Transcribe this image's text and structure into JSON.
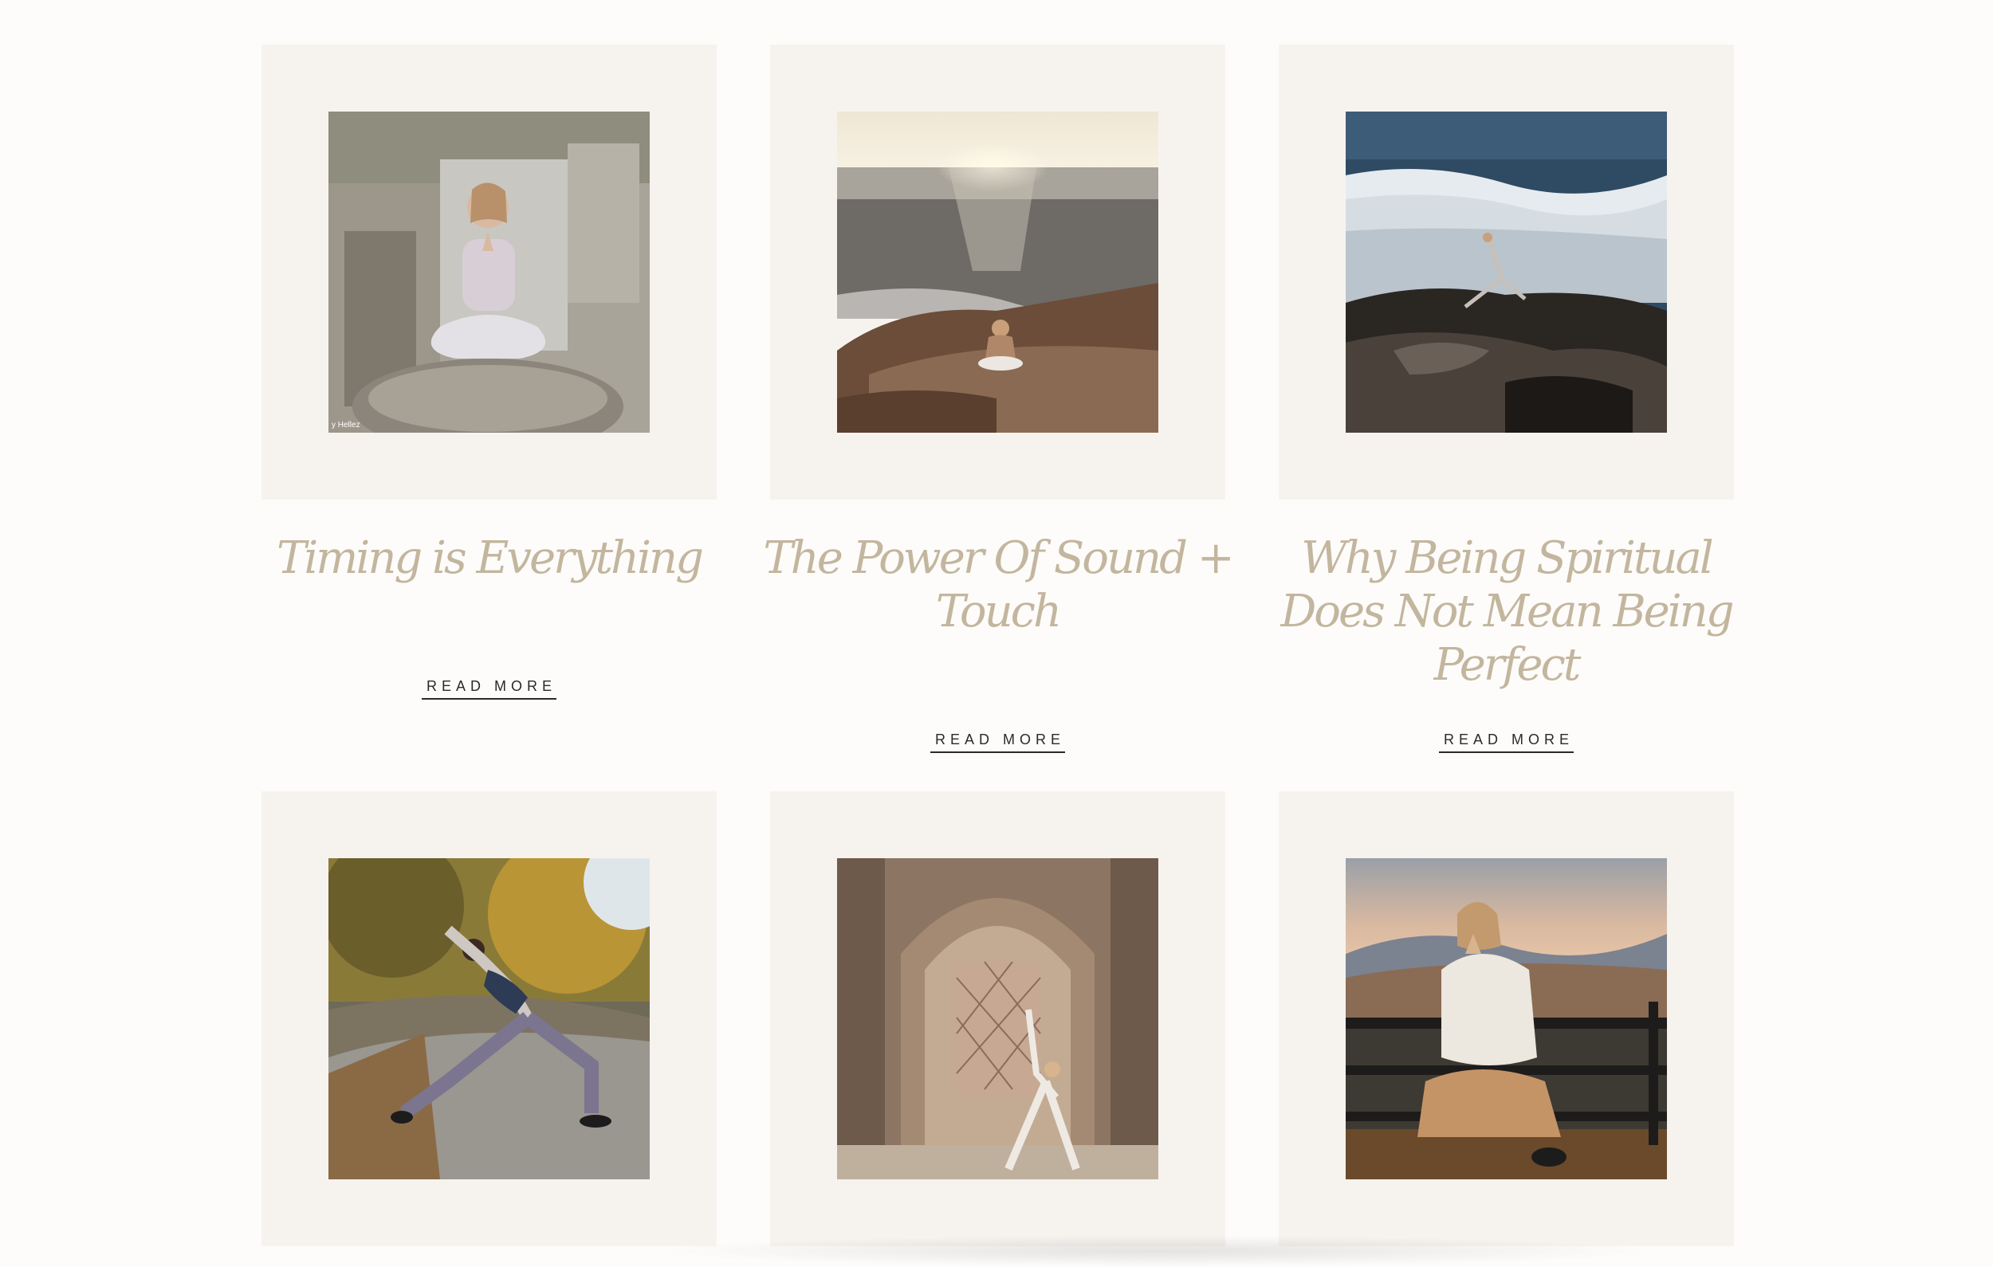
{
  "posts": [
    {
      "title": "Timing is Everything",
      "read_more": "READ MORE",
      "photo": "meditation-on-rock-photo",
      "watermark": "y Hellez"
    },
    {
      "title": "The Power Of Sound + Touch",
      "read_more": "READ MORE",
      "photo": "ocean-sunset-meditation-photo"
    },
    {
      "title": "Why Being Spiritual Does Not Mean Being Perfect",
      "read_more": "READ MORE",
      "photo": "rocky-shore-pose-photo"
    },
    {
      "photo": "park-warrior-pose-photo"
    },
    {
      "photo": "arch-triangle-pose-photo"
    },
    {
      "photo": "mountain-view-meditation-photo"
    }
  ],
  "colors": {
    "background": "#fdfcfa",
    "card_frame": "#f6f3ef",
    "title": "#c3b69e",
    "link": "#2c2a27"
  }
}
